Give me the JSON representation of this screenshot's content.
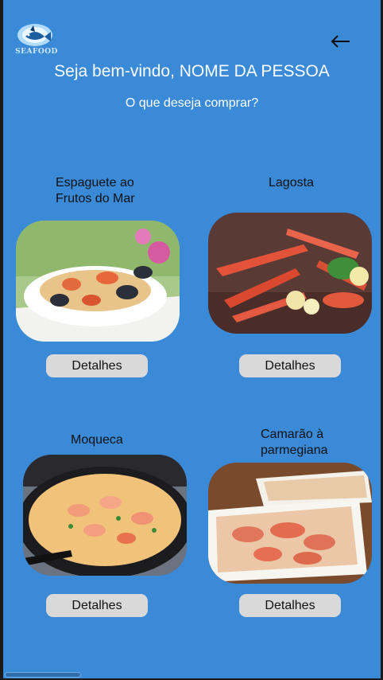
{
  "app": {
    "logo_text": "SEAFOOD"
  },
  "header": {
    "title": "Seja bem-vindo, NOME DA PESSOA",
    "subtitle": "O que deseja comprar?"
  },
  "products": [
    {
      "name_line1": "Espaguete ao",
      "name_line2": "Frutos do Mar",
      "button": "Detalhes"
    },
    {
      "name_line1": "Lagosta",
      "name_line2": "",
      "button": "Detalhes"
    },
    {
      "name_line1": "Moqueca",
      "name_line2": "",
      "button": "Detalhes"
    },
    {
      "name_line1": "Camarão à",
      "name_line2": "parmegiana",
      "button": "Detalhes"
    }
  ],
  "colors": {
    "background": "#3a8ad8",
    "button": "#d9d9d9"
  },
  "icons": {
    "back": "arrow-left-icon",
    "logo": "seafood-logo"
  }
}
